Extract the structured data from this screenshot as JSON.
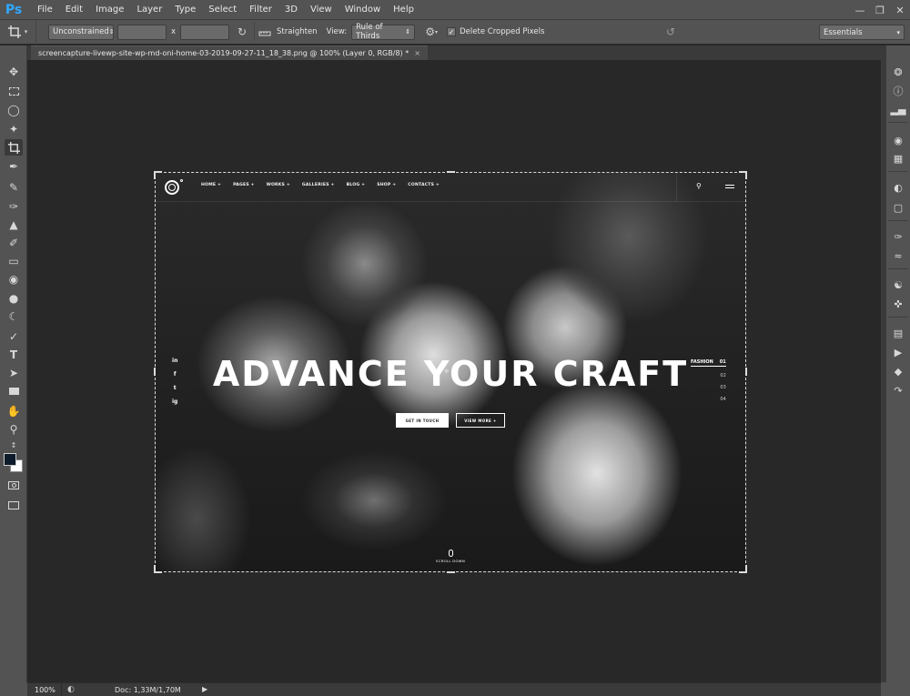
{
  "app": {
    "logo": "Ps",
    "menu": [
      "File",
      "Edit",
      "Image",
      "Layer",
      "Type",
      "Select",
      "Filter",
      "3D",
      "View",
      "Window",
      "Help"
    ],
    "window_controls": [
      "minimize",
      "restore",
      "close"
    ]
  },
  "options_bar": {
    "ratio_preset": "Unconstrained",
    "width_value": "",
    "times_symbol": "x",
    "height_value": "",
    "straighten_label": "Straighten",
    "view_label": "View:",
    "view_value": "Rule of Thirds",
    "delete_cropped_label": "Delete Cropped Pixels",
    "delete_cropped_checked": true,
    "workspace": "Essentials"
  },
  "document_tab": {
    "title": "screencapture-livewp-site-wp-md-oni-home-03-2019-09-27-11_18_38.png @ 100% (Layer 0, RGB/8) *",
    "close": "×"
  },
  "tools": [
    "move-tool",
    "marquee-tool",
    "lasso-tool",
    "magic-wand-tool",
    "crop-tool",
    "eyedropper-tool",
    "healing-brush-tool",
    "brush-tool",
    "clone-stamp-tool",
    "history-brush-tool",
    "eraser-tool",
    "paint-bucket-tool",
    "blur-tool",
    "dodge-tool",
    "pen-tool",
    "type-tool",
    "path-selection-tool",
    "rectangle-tool",
    "hand-tool",
    "zoom-tool"
  ],
  "colors": {
    "foreground": "#0d1b2a",
    "background": "#ffffff",
    "ps_blue": "#31a8ff"
  },
  "canvas_page": {
    "nav_links": [
      "HOME +",
      "PAGES +",
      "WORKS +",
      "GALLERIES +",
      "BLOG +",
      "SHOP +",
      "CONTACTS +"
    ],
    "social_icons": [
      "in",
      "f",
      "t",
      "ig"
    ],
    "hero_title": "ADVANCE YOUR CRAFT",
    "btn_primary": "GET IN TOUCH",
    "btn_secondary": "VIEW MORE +",
    "slider_active_label": "FASHION",
    "slider_active_num": "01",
    "slider_nums": [
      "02",
      "03",
      "04"
    ],
    "scroll_label": "SCROLL DOWN"
  },
  "status_bar": {
    "zoom": "100%",
    "doc_info": "Doc: 1,33M/1,70M"
  }
}
